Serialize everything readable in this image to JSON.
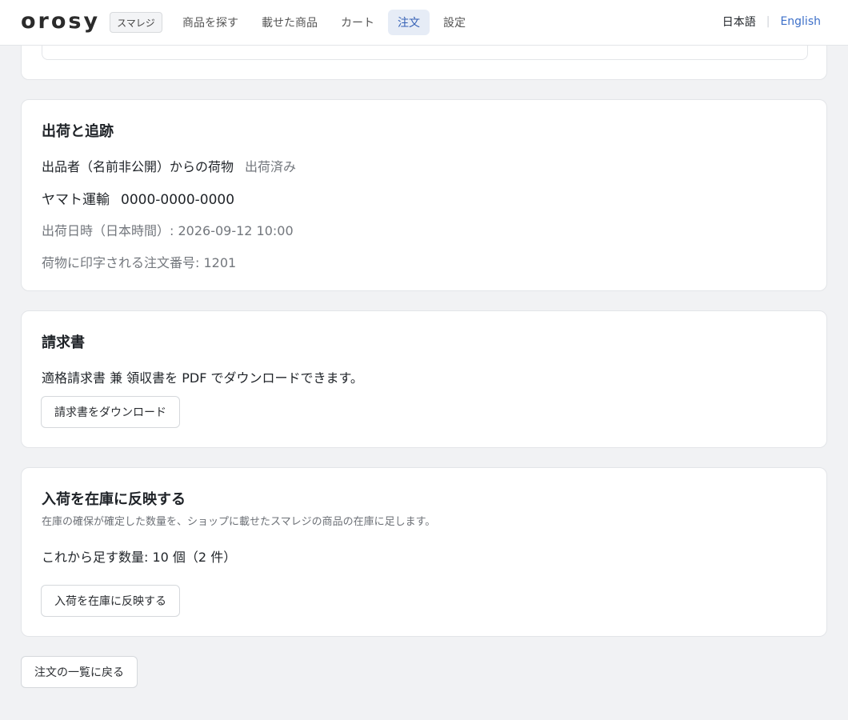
{
  "header": {
    "logo": "orosy",
    "app_badge": "スマレジ",
    "nav": [
      {
        "label": "商品を探す",
        "active": false
      },
      {
        "label": "載せた商品",
        "active": false
      },
      {
        "label": "カート",
        "active": false
      },
      {
        "label": "注文",
        "active": true
      },
      {
        "label": "設定",
        "active": false
      }
    ],
    "lang_ja": "日本語",
    "lang_separator": "|",
    "lang_en": "English"
  },
  "shipping": {
    "title": "出荷と追跡",
    "sender": "出品者（名前非公開）からの荷物",
    "status": "出荷済み",
    "carrier": "ヤマト運輸",
    "tracking_number": "0000-0000-0000",
    "shipped_at": "出荷日時（日本時間）: 2026-09-12 10:00",
    "order_number_label": "荷物に印字される注文番号: 1201"
  },
  "invoice": {
    "title": "請求書",
    "description": "適格請求書 兼 領収書を PDF でダウンロードできます。",
    "download_label": "請求書をダウンロード"
  },
  "stock": {
    "title": "入荷を在庫に反映する",
    "subtitle": "在庫の確保が確定した数量を、ショップに載せたスマレジの商品の在庫に足します。",
    "quantity_text": "これから足す数量: 10 個（2 件）",
    "apply_label": "入荷を在庫に反映する"
  },
  "footer": {
    "back_label": "注文の一覧に戻る"
  },
  "colors": {
    "background": "#f1f2f4",
    "accent": "#3561b5",
    "active_nav_bg": "#e6ecf6",
    "muted_text": "#73777d"
  }
}
